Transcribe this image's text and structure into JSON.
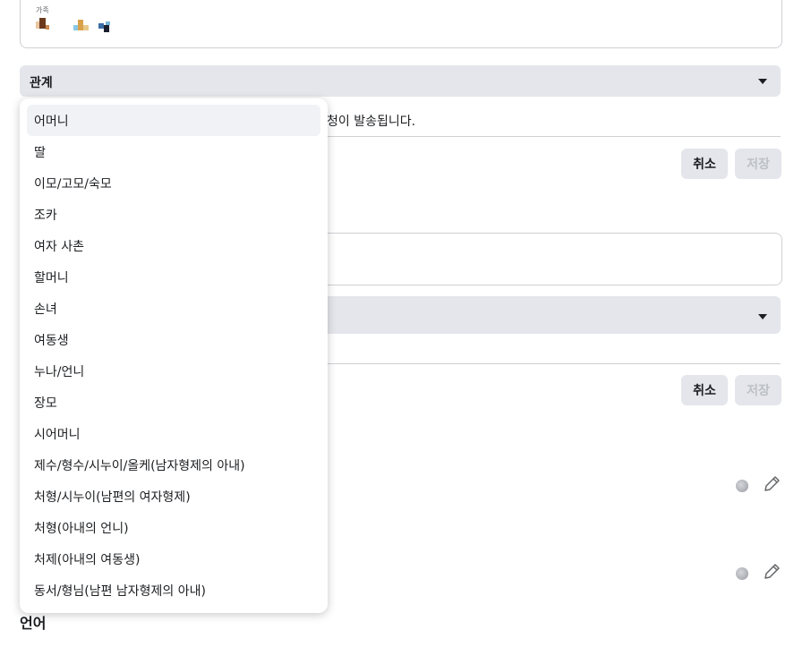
{
  "family_field": {
    "label": "가족"
  },
  "relationship": {
    "label": "관계"
  },
  "notice": {
    "text": "청이 발송됩니다."
  },
  "actions": {
    "cancel_label": "취소",
    "save_label": "저장"
  },
  "section": {
    "language_title": "언어"
  },
  "menu": {
    "items": [
      "어머니",
      "딸",
      "이모/고모/숙모",
      "조카",
      "여자 사촌",
      "할머니",
      "손녀",
      "여동생",
      "누나/언니",
      "장모",
      "시어머니",
      "제수/형수/시누이/올케(남자형제의 아내)",
      "처형/시누이(남편의 여자형제)",
      "처형(아내의 언니)",
      "처제(아내의 여동생)",
      "동서/형님(남편 남자형제의 아내)"
    ],
    "active_index": 0
  },
  "icons": {
    "caret": "caret-down-icon",
    "audience": "globe-icon",
    "edit": "pencil-icon"
  },
  "colors": {
    "select_bg": "#e4e6eb",
    "hover_bg": "#f0f2f5",
    "border": "#ced0d4",
    "disabled_text": "#bcc0c4"
  }
}
